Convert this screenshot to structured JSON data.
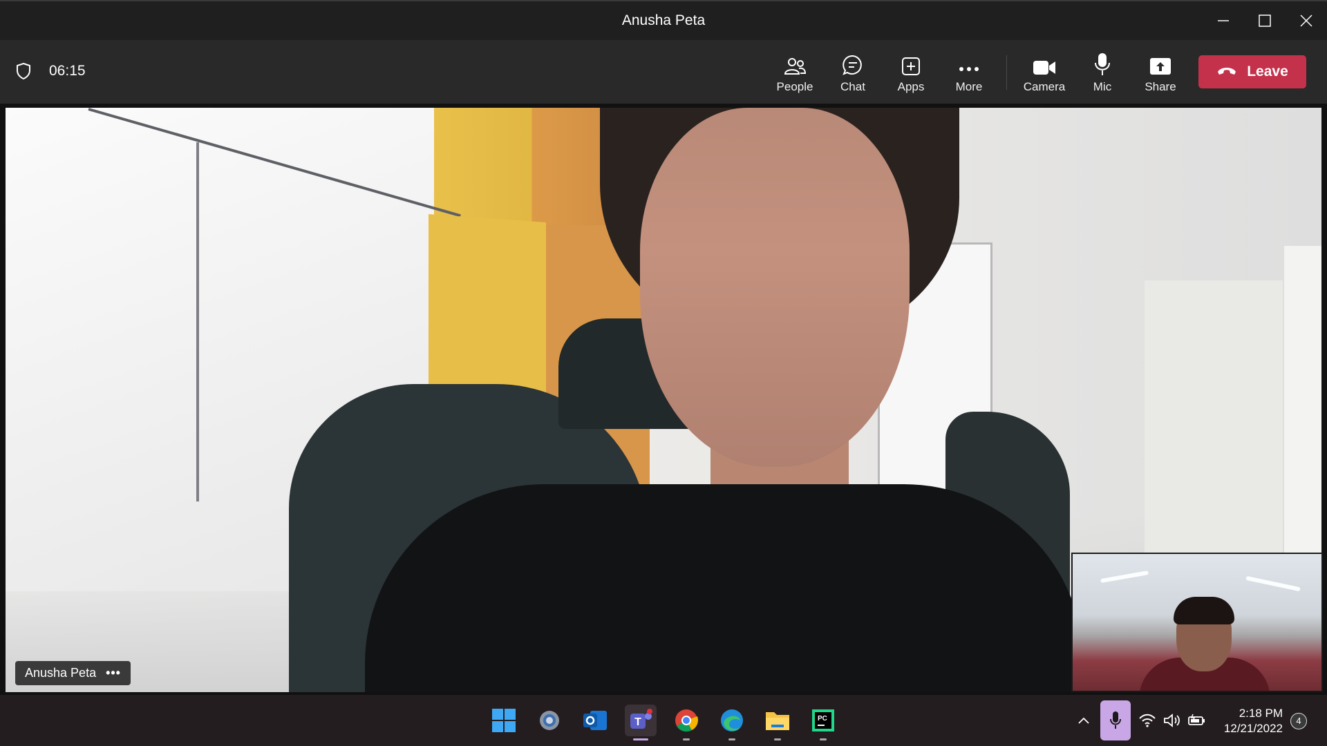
{
  "window": {
    "title": "Anusha Peta"
  },
  "toolbar": {
    "timer": "06:15",
    "buttons": [
      {
        "label": "People",
        "icon": "people-icon"
      },
      {
        "label": "Chat",
        "icon": "chat-icon"
      },
      {
        "label": "Apps",
        "icon": "apps-icon"
      },
      {
        "label": "More",
        "icon": "more-icon"
      },
      {
        "label": "Camera",
        "icon": "camera-icon"
      },
      {
        "label": "Mic",
        "icon": "mic-icon"
      },
      {
        "label": "Share",
        "icon": "share-icon"
      }
    ],
    "leave_label": "Leave",
    "leave_color": "#c4314b"
  },
  "video": {
    "participant_name": "Anusha Peta",
    "options": "•••"
  },
  "taskbar": {
    "apps": [
      "start",
      "settings",
      "outlook",
      "teams",
      "chrome",
      "edge",
      "file-explorer",
      "pycharm"
    ],
    "active_app": "teams",
    "time": "2:18 PM",
    "date": "12/21/2022",
    "notification_count": "4"
  }
}
